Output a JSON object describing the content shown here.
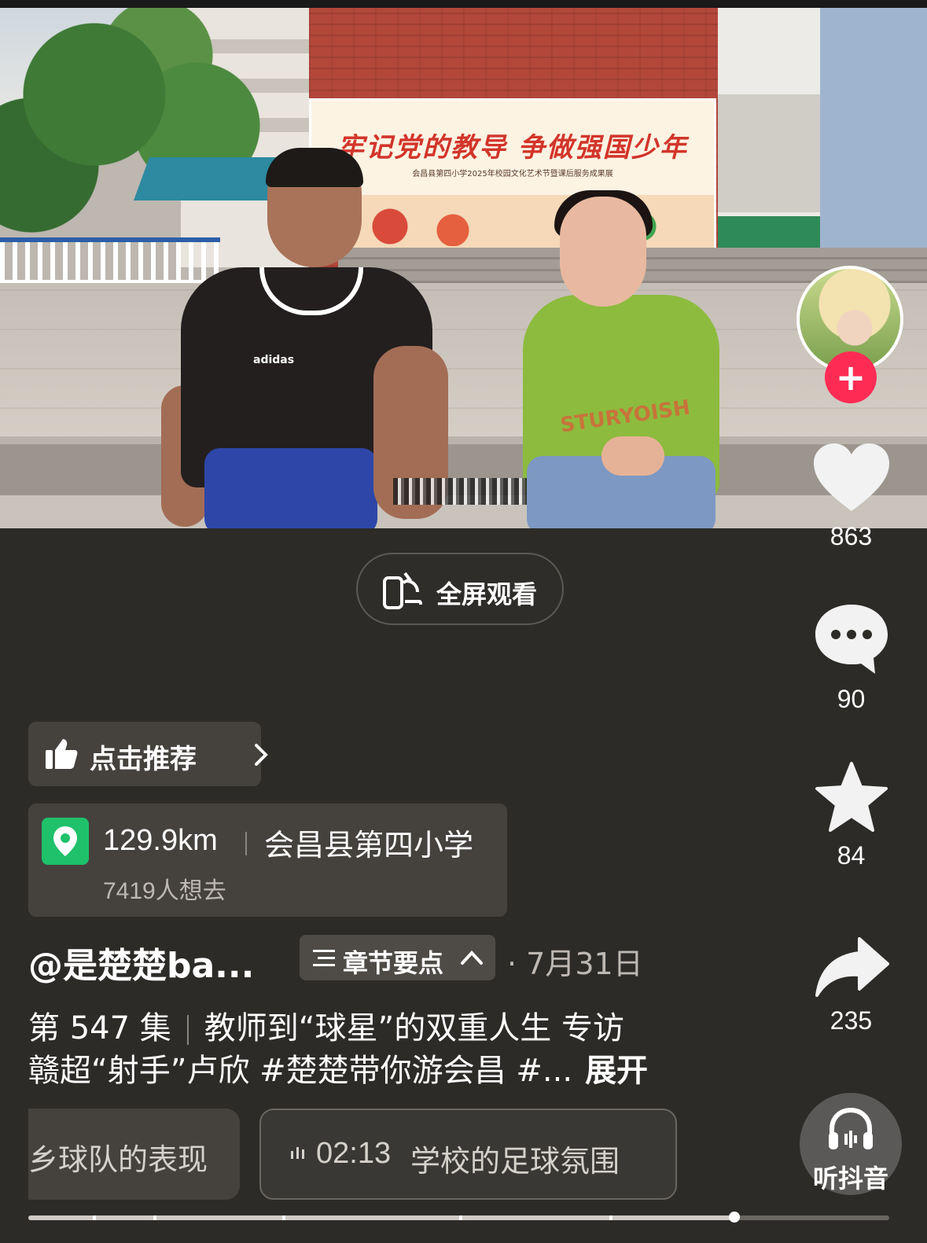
{
  "video": {
    "banner_title": "牢记党的教导  争做强国少年",
    "banner_subtitle": "会昌县第四小学2025年校园文化艺术节暨课后服务成果展",
    "shirt_logo": "adidas",
    "shirt_text": "STURYOISH"
  },
  "actions": {
    "likes": "863",
    "comments": "90",
    "favorites": "84",
    "shares": "235",
    "listen_label": "听抖音"
  },
  "fullscreen_label": "全屏观看",
  "recommend_label": "点击推荐",
  "location": {
    "distance": "129.9km",
    "name": "会昌县第四小学",
    "want_to_go": "7419人想去"
  },
  "author": {
    "name": "@是楚楚ba...",
    "chapter_label": "章节要点",
    "date": "· 7月31日"
  },
  "description": {
    "episode": "第 547 集",
    "line1": "教师到“球星”的双重人生 专访",
    "line2": "赣超“射手”卢欣 #楚楚带你游会昌 #...",
    "expand": "展开"
  },
  "chapters": [
    {
      "label": "乡球队的表现"
    },
    {
      "time": "02:13",
      "label": "学校的足球氛围"
    }
  ],
  "progress": {
    "fraction": 0.82,
    "chapter_marks": [
      0.075,
      0.145,
      0.295,
      0.5,
      0.675
    ]
  },
  "icons": [
    "plus-icon",
    "heart-icon",
    "comment-icon",
    "star-icon",
    "share-icon",
    "headphones-icon",
    "rotate-phone-icon",
    "thumbs-up-icon",
    "chevron-right-icon",
    "location-pin-icon",
    "list-icon",
    "chevron-up-icon",
    "audio-bars-icon"
  ],
  "colors": {
    "accent_red": "#fe2c55",
    "location_green": "#1fc16b",
    "background": "#2d2b28"
  }
}
